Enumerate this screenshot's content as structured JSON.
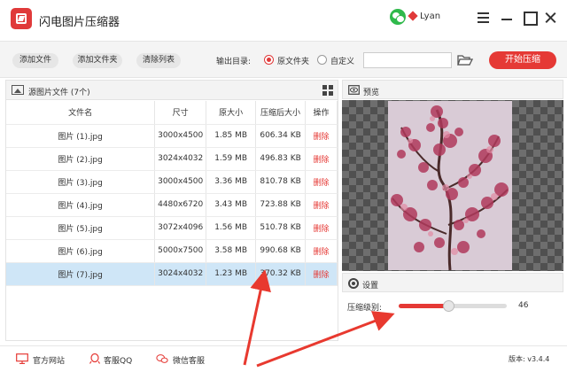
{
  "app": {
    "title": "闪电图片压缩器",
    "username": "Lyan"
  },
  "icons": {
    "logo": "lightning-logo-icon",
    "wechat": "wechat-icon",
    "vip": "vip-diamond-icon",
    "menu": "menu-icon",
    "minimize": "minimize-icon",
    "maximize": "maximize-icon",
    "close": "close-icon",
    "folder": "folder-icon",
    "image": "image-icon",
    "grid": "grid-view-icon",
    "eye": "eye-icon",
    "gear": "gear-icon",
    "website": "monitor-icon",
    "qq": "qq-icon",
    "wechat_service": "wechat-icon"
  },
  "colors": {
    "accent": "#e53935",
    "selected_row": "#cfe6f7",
    "annotation_arrow": "#e8392f"
  },
  "toolbar": {
    "add_file": "添加文件",
    "add_folder": "添加文件夹",
    "clear_list": "清除列表",
    "output_label": "输出目录:",
    "option_original": "原文件夹",
    "option_custom": "自定义",
    "selected_option": "原文件夹",
    "path_value": "",
    "start": "开始压缩"
  },
  "file_panel": {
    "title": "源图片文件 (7个)",
    "columns": [
      "文件名",
      "尺寸",
      "原大小",
      "压缩后大小",
      "操作"
    ],
    "rows": [
      {
        "name": "图片 (1).jpg",
        "size": "3000x4500",
        "original": "1.85 MB",
        "compressed": "606.34 KB",
        "action": "删除"
      },
      {
        "name": "图片 (2).jpg",
        "size": "3024x4032",
        "original": "1.59 MB",
        "compressed": "496.83 KB",
        "action": "删除"
      },
      {
        "name": "图片 (3).jpg",
        "size": "3000x4500",
        "original": "3.36 MB",
        "compressed": "810.78 KB",
        "action": "删除"
      },
      {
        "name": "图片 (4).jpg",
        "size": "4480x6720",
        "original": "3.43 MB",
        "compressed": "723.88 KB",
        "action": "删除"
      },
      {
        "name": "图片 (5).jpg",
        "size": "3072x4096",
        "original": "1.56 MB",
        "compressed": "510.78 KB",
        "action": "删除"
      },
      {
        "name": "图片 (6).jpg",
        "size": "5000x7500",
        "original": "3.58 MB",
        "compressed": "990.68 KB",
        "action": "删除"
      },
      {
        "name": "图片 (7).jpg",
        "size": "3024x4032",
        "original": "1.23 MB",
        "compressed": "370.32 KB",
        "action": "删除"
      }
    ],
    "selected_row_index": 6
  },
  "preview": {
    "title": "预览"
  },
  "settings": {
    "title": "设置",
    "level_label": "压缩级别:",
    "level_value": "46",
    "level_fraction": 0.46
  },
  "footer": {
    "website": "官方网站",
    "qq": "客服QQ",
    "wechat": "微信客服",
    "version": "版本: v3.4.4"
  }
}
